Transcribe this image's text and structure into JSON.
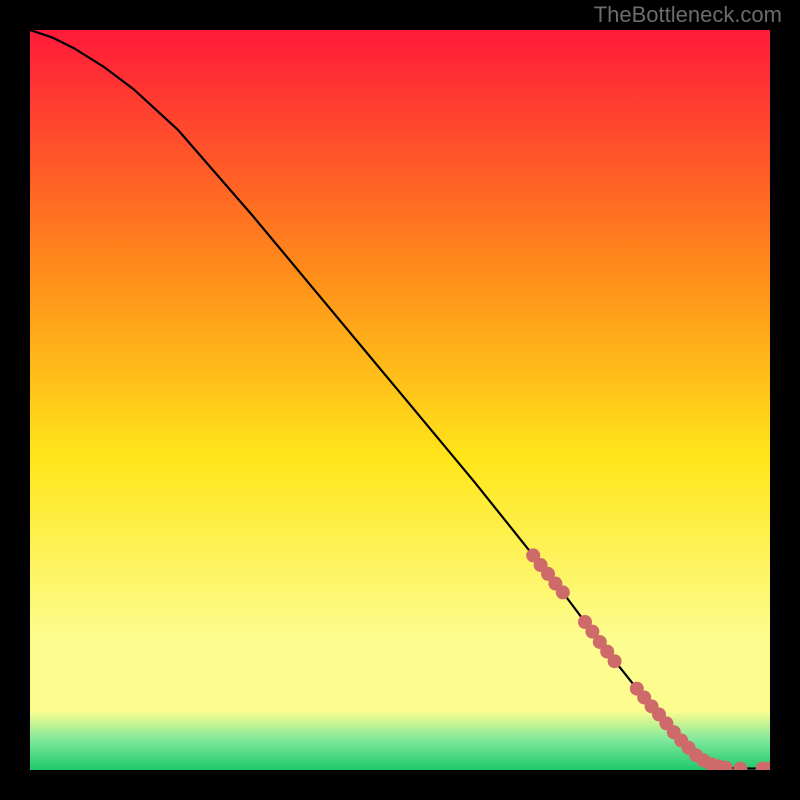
{
  "watermark": "TheBottleneck.com",
  "colors": {
    "background": "#000000",
    "curve": "#000000",
    "dots": "#cf6a6a",
    "gradient_top": "#ff1a3a",
    "gradient_mid_upper": "#ff8a1a",
    "gradient_mid": "#ffe61a",
    "gradient_lower_yellow": "#fdfd8f",
    "gradient_green_light": "#7de89a",
    "gradient_green": "#1fc96b"
  },
  "chart_data": {
    "type": "line",
    "title": "",
    "xlabel": "",
    "ylabel": "",
    "xlim": [
      0,
      100
    ],
    "ylim": [
      0,
      100
    ],
    "series": [
      {
        "name": "curve",
        "x": [
          0,
          3,
          6,
          10,
          14,
          20,
          30,
          40,
          50,
          60,
          68,
          72,
          75,
          78,
          80,
          82,
          85,
          88,
          90,
          92,
          94,
          96,
          98,
          100
        ],
        "y": [
          100,
          99,
          97.5,
          95,
          92,
          86.5,
          75,
          63,
          51,
          39,
          29,
          24,
          20,
          16,
          13.5,
          11,
          7.5,
          4,
          2,
          0.8,
          0.3,
          0.2,
          0.2,
          0.2
        ]
      }
    ],
    "highlight_dots": {
      "name": "dots",
      "points": [
        {
          "x": 68,
          "y": 29
        },
        {
          "x": 69,
          "y": 27.7
        },
        {
          "x": 70,
          "y": 26.5
        },
        {
          "x": 71,
          "y": 25.2
        },
        {
          "x": 72,
          "y": 24
        },
        {
          "x": 75,
          "y": 20
        },
        {
          "x": 76,
          "y": 18.7
        },
        {
          "x": 77,
          "y": 17.3
        },
        {
          "x": 78,
          "y": 16
        },
        {
          "x": 79,
          "y": 14.7
        },
        {
          "x": 82,
          "y": 11
        },
        {
          "x": 83,
          "y": 9.8
        },
        {
          "x": 84,
          "y": 8.6
        },
        {
          "x": 85,
          "y": 7.5
        },
        {
          "x": 86,
          "y": 6.3
        },
        {
          "x": 87,
          "y": 5.1
        },
        {
          "x": 88,
          "y": 4
        },
        {
          "x": 89,
          "y": 3
        },
        {
          "x": 90,
          "y": 2
        },
        {
          "x": 91,
          "y": 1.3
        },
        {
          "x": 92,
          "y": 0.8
        },
        {
          "x": 93,
          "y": 0.5
        },
        {
          "x": 94,
          "y": 0.3
        },
        {
          "x": 96,
          "y": 0.2
        },
        {
          "x": 99,
          "y": 0.2
        },
        {
          "x": 100,
          "y": 0.2
        }
      ]
    }
  }
}
